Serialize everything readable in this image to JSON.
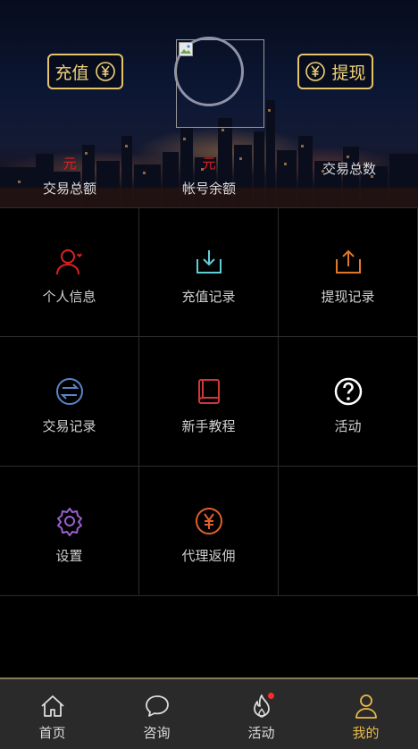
{
  "header": {
    "recharge_label": "充值",
    "withdraw_label": "提现",
    "stats": [
      {
        "value": "元",
        "label": "交易总额"
      },
      {
        "value": "元",
        "label": "帐号余额"
      },
      {
        "value": "",
        "label": "交易总数"
      }
    ]
  },
  "menu": [
    {
      "label": "个人信息",
      "icon": "user-icon",
      "color": "#e02020"
    },
    {
      "label": "充值记录",
      "icon": "download-icon",
      "color": "#5fd0d8"
    },
    {
      "label": "提现记录",
      "icon": "upload-icon",
      "color": "#e0782a"
    },
    {
      "label": "交易记录",
      "icon": "exchange-icon",
      "color": "#5b84c8"
    },
    {
      "label": "新手教程",
      "icon": "book-icon",
      "color": "#d03838"
    },
    {
      "label": "活动",
      "icon": "question-icon",
      "color": "#ffffff"
    },
    {
      "label": "设置",
      "icon": "gear-icon",
      "color": "#9a5fd0"
    },
    {
      "label": "代理返佣",
      "icon": "yuan-coin-icon",
      "color": "#e0602a"
    }
  ],
  "tabs": [
    {
      "label": "首页",
      "icon": "home-icon"
    },
    {
      "label": "咨询",
      "icon": "chat-icon"
    },
    {
      "label": "活动",
      "icon": "flame-icon",
      "badge": true
    },
    {
      "label": "我的",
      "icon": "person-icon",
      "active": true
    }
  ],
  "colors": {
    "accent": "#e8b94a",
    "gold_border": "#e6c36a",
    "red": "#e02020"
  }
}
